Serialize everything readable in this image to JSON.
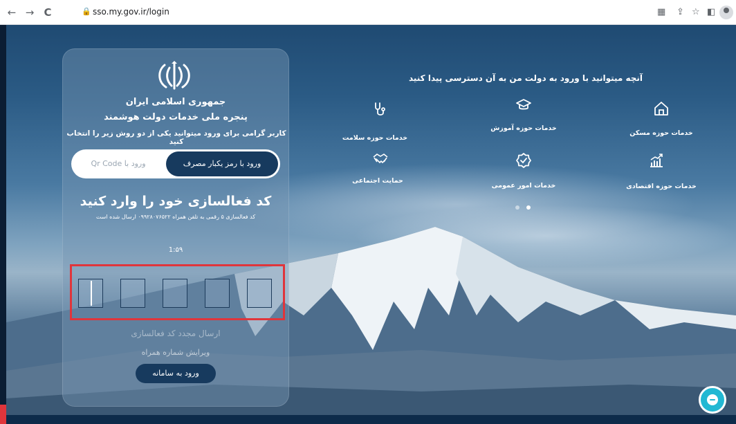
{
  "browser": {
    "url": "sso.my.gov.ir/login",
    "back_icon": "←",
    "forward_icon": "→",
    "reload_icon": "C"
  },
  "login": {
    "country": "جمهوری اسلامی ایران",
    "portal_title": "پنجره ملی خدمات دولت هوشمند",
    "instruction": "کاربر گرامی برای ورود میتوانید یکی از دو روش زیر را انتخاب کنید",
    "tab_otp": "ورود با رمز یکبار مصرف",
    "tab_qr": "ورود با Qr Code",
    "code_heading": "کد فعالسازی خود را وارد کنید",
    "code_subtitle": "کد فعالسازی ۵ رقمی به تلفن همراه ۰۹۹۲۸۰۷۶۵۲۲ ارسال شده است",
    "timer": "1:۵۹",
    "resend": "ارسال مجدد کد فعالسازی",
    "edit_phone": "ویرایش شماره همراه",
    "submit": "ورود به سامانه"
  },
  "services": {
    "title": "آنچه میتوانید با ورود به دولت من به آن دسترسی پیدا کنید",
    "items": [
      {
        "label": "خدمات حوزه مسکن",
        "icon": "home-icon"
      },
      {
        "label": "خدمات حوزه آموزش",
        "icon": "graduation-cap-icon"
      },
      {
        "label": "خدمات حوزه سلامت",
        "icon": "stethoscope-icon"
      },
      {
        "label": "خدمات حوزه اقتصادی",
        "icon": "chart-growth-icon"
      },
      {
        "label": "خدمات امور عمومی",
        "icon": "verified-badge-icon"
      },
      {
        "label": "حمایت اجتماعی",
        "icon": "handshake-icon"
      }
    ]
  },
  "colors": {
    "primary": "#173a5e",
    "highlight": "#e0353b",
    "chat": "#22b8d3"
  }
}
